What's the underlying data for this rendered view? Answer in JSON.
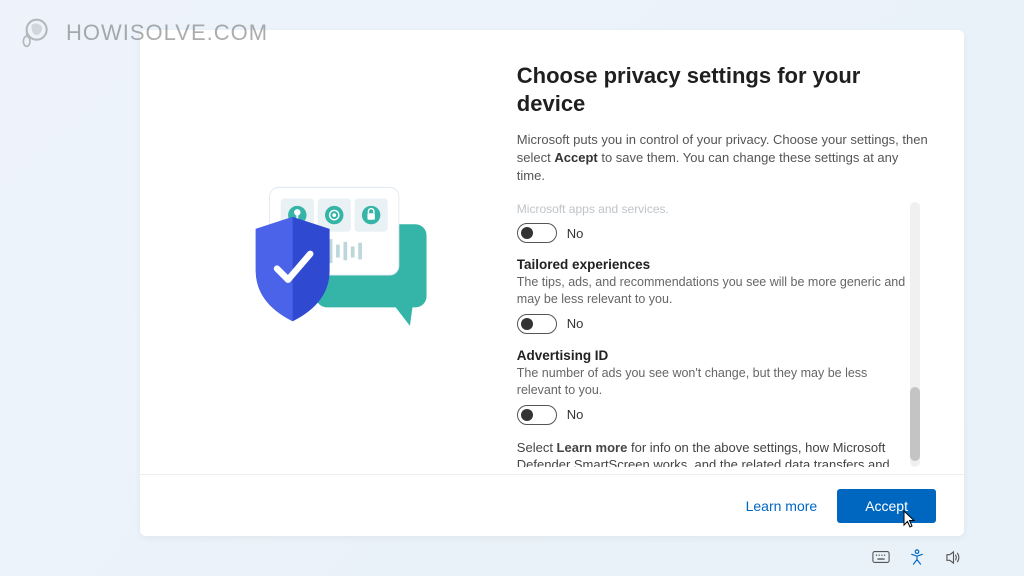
{
  "watermark": {
    "text": "HOWISOLVE.COM"
  },
  "title": "Choose privacy settings for your device",
  "subtitle_pre": "Microsoft puts you in control of your privacy. Choose your settings, then select ",
  "subtitle_bold": "Accept",
  "subtitle_post": " to save them. You can change these settings at any time.",
  "partial_setting_text": "Microsoft apps and services.",
  "settings": [
    {
      "title": "",
      "desc": "",
      "toggle_label": "No"
    },
    {
      "title": "Tailored experiences",
      "desc": "The tips, ads, and recommendations you see will be more generic and may be less relevant to you.",
      "toggle_label": "No"
    },
    {
      "title": "Advertising ID",
      "desc": "The number of ads you see won't change, but they may be less relevant to you.",
      "toggle_label": "No"
    }
  ],
  "footer_note_pre": "Select ",
  "footer_note_bold": "Learn more",
  "footer_note_post": " for info on the above settings, how Microsoft Defender SmartScreen works, and the related data transfers and uses.",
  "buttons": {
    "learn_more": "Learn more",
    "accept": "Accept"
  },
  "icons": {
    "keyboard": "keyboard-icon",
    "accessibility": "accessibility-icon",
    "volume": "volume-icon"
  },
  "colors": {
    "primary": "#0067c0",
    "teal": "#35b5a7",
    "shield": "#2f49d1"
  }
}
